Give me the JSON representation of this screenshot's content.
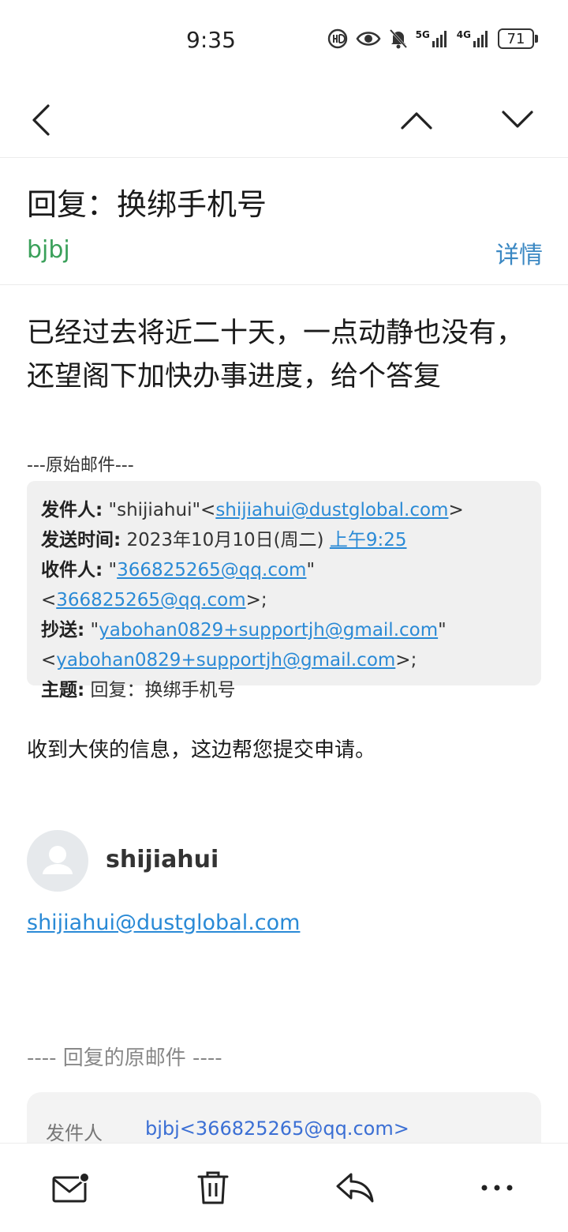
{
  "status_bar": {
    "time": "9:35",
    "icons": [
      "hd-call-icon",
      "eye-icon",
      "mute-bell-icon",
      "5g-signal-icon",
      "4g-signal-icon"
    ],
    "network_5g": "5G",
    "network_4g": "4G",
    "battery": "71"
  },
  "nav": {
    "back_icon": "chevron-left-icon",
    "prev_icon": "chevron-up-icon",
    "next_icon": "chevron-down-icon"
  },
  "email": {
    "subject": "回复：换绑手机号",
    "sender": "bjbj",
    "details_label": "详情",
    "body": "已经过去将近二十天，一点动静也没有，还望阁下加快办事进度，给个答复",
    "original_divider": "---原始邮件---",
    "original": {
      "from_label": "发件人:",
      "from_name": "\"shijiahui\"<",
      "from_email": "shijiahui@dustglobal.com",
      "from_close": ">",
      "sent_label": "发送时间:",
      "sent_date": "2023年10月10日(周二)",
      "sent_time": "上午9:25",
      "to_label": "收件人:",
      "to_open": "\"",
      "to_name": "366825265@qq.com",
      "to_mid": "\"<",
      "to_email": "366825265@qq.com",
      "to_close": ">;",
      "cc_label": "抄送:",
      "cc_open": "\"",
      "cc_name": "yabohan0829+supportjh@gmail.com",
      "cc_mid": "\"",
      "cc_lt": "<",
      "cc_email": "yabohan0829+supportjh@gmail.com",
      "cc_close": ">;",
      "subject_label": "主题:",
      "subject_value": "回复：换绑手机号"
    },
    "reply_text": "收到大侠的信息，这边帮您提交申请。",
    "signature": {
      "name": "shijiahui",
      "email": "shijiahui@dustglobal.com"
    },
    "replied_divider": "---- 回复的原邮件 ----",
    "replied": {
      "from_label": "发件人",
      "from_value": "bjbj<366825265@qq.com>"
    }
  },
  "toolbar": {
    "icons": [
      "mail-unread-icon",
      "trash-icon",
      "reply-icon",
      "more-icon"
    ]
  },
  "colors": {
    "sender_green": "#3aa05a",
    "link_blue": "#2a8ad6",
    "details_blue": "#3b88c3"
  }
}
